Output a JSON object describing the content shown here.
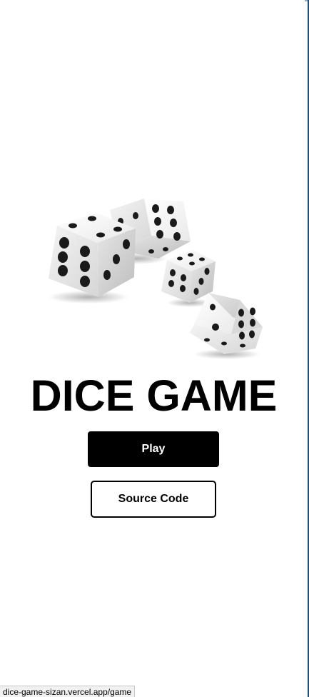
{
  "title": "DICE GAME",
  "buttons": {
    "play_label": "Play",
    "source_label": "Source Code"
  },
  "status_bar": {
    "url": "dice-game-sizan.vercel.app/game"
  },
  "illustration": {
    "icon": "dice-icon",
    "dice_count": 4
  },
  "colors": {
    "play_background": "#000000",
    "play_text": "#ffffff",
    "source_border": "#000000",
    "page_background": "#ffffff"
  }
}
